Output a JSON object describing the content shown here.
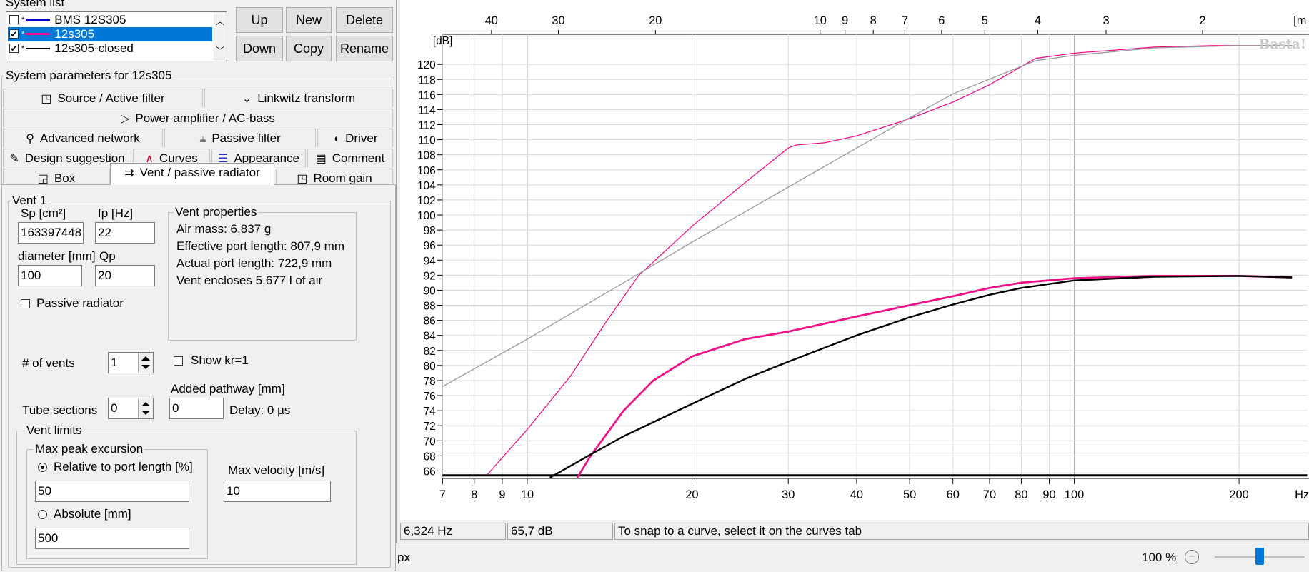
{
  "system_list": {
    "title": "System list",
    "items": [
      {
        "checked": false,
        "line_color": "#0000cc",
        "label": "BMS 12S305",
        "selected": false
      },
      {
        "checked": true,
        "line_color": "#ee1188",
        "label": "12s305",
        "selected": true
      },
      {
        "checked": true,
        "line_color": "#000000",
        "label": "12s305-closed",
        "selected": false
      }
    ],
    "buttons": {
      "up": "Up",
      "new": "New",
      "delete": "Delete",
      "down": "Down",
      "copy": "Copy",
      "rename": "Rename"
    }
  },
  "system_params": {
    "title": "System parameters for 12s305",
    "tabs": [
      {
        "key": "source",
        "icon": "◳",
        "label": "Source / Active filter"
      },
      {
        "key": "linkwitz",
        "icon": "⌄",
        "label": "Linkwitz transform"
      },
      {
        "key": "power",
        "icon": "▷",
        "label": "Power amplifier / AC-bass"
      },
      {
        "key": "advanced",
        "icon": "⚲",
        "label": "Advanced network"
      },
      {
        "key": "passive",
        "icon": "⫨",
        "label": "Passive filter"
      },
      {
        "key": "driver",
        "icon": "◖",
        "label": "Driver"
      },
      {
        "key": "design",
        "icon": "✎",
        "label": "Design suggestion"
      },
      {
        "key": "curves",
        "icon": "∧",
        "label": "Curves"
      },
      {
        "key": "appearance",
        "icon": "☰",
        "label": "Appearance"
      },
      {
        "key": "comment",
        "icon": "▤",
        "label": "Comment"
      },
      {
        "key": "box",
        "icon": "◲",
        "label": "Box"
      },
      {
        "key": "vent",
        "icon": "⇉",
        "label": "Vent / passive radiator"
      },
      {
        "key": "room",
        "icon": "◳",
        "label": "Room gain"
      }
    ]
  },
  "vent": {
    "group_title": "Vent 1",
    "sp_label": "Sp [cm²]",
    "sp_value": "163397448",
    "fp_label": "fp [Hz]",
    "fp_value": "22",
    "diameter_label": "diameter [mm]",
    "diameter_value": "100",
    "qp_label": "Qp",
    "qp_value": "20",
    "passive_radiator_label": "Passive radiator",
    "properties": {
      "title": "Vent properties",
      "air_mass": "Air mass: 6,837 g",
      "effective_length": "Effective port length: 807,9 mm",
      "actual_length": "Actual port length: 722,9 mm",
      "encloses": "Vent encloses 5,677 l of air"
    },
    "num_vents_label": "# of vents",
    "num_vents_value": "1",
    "show_kr_label": "Show kr=1",
    "added_pathway_label": "Added pathway [mm]",
    "added_pathway_value": "0",
    "tube_sections_label": "Tube sections",
    "tube_sections_value": "0",
    "delay_text": "Delay: 0 µs",
    "limits": {
      "title": "Vent limits",
      "max_peak_title": "Max peak excursion",
      "relative_label": "Relative to port length [%]",
      "relative_value": "50",
      "absolute_label": "Absolute [mm]",
      "absolute_value": "500",
      "max_velocity_label": "Max velocity [m/s]",
      "max_velocity_value": "10"
    }
  },
  "chart_data": {
    "type": "line",
    "ylabel": "[dB]",
    "watermark": "Basta!",
    "x_unit": "Hz",
    "top_axis_unit": "[m",
    "xscale": "log",
    "xlim": [
      7,
      250
    ],
    "ylim": [
      65,
      124
    ],
    "x_ticks": [
      7,
      8,
      9,
      10,
      20,
      30,
      40,
      50,
      60,
      70,
      80,
      90,
      100,
      200
    ],
    "x_ticklabels": [
      "7",
      "8",
      "9",
      "10",
      "20",
      "30",
      "40",
      "50",
      "60",
      "70",
      "80",
      "90",
      "100",
      "200"
    ],
    "y_ticks": [
      66,
      68,
      70,
      72,
      74,
      76,
      78,
      80,
      82,
      84,
      86,
      88,
      90,
      92,
      94,
      96,
      98,
      100,
      102,
      104,
      106,
      108,
      110,
      112,
      114,
      116,
      118,
      120
    ],
    "top_ticklabels": [
      "40",
      "30",
      "20",
      "10",
      "9",
      "8",
      "7",
      "6",
      "5",
      "4",
      "3",
      "2"
    ],
    "top_tick_freqs": [
      8.6,
      11.4,
      17.15,
      34.3,
      38.1,
      42.9,
      49,
      57.2,
      68.6,
      85.75,
      114.3,
      171.5
    ],
    "grid": true,
    "series": [
      {
        "color": "#ee1188",
        "width": 1.3,
        "x": [
          8.45,
          10,
          12,
          14,
          16,
          20,
          25,
          30,
          31,
          35,
          40,
          50,
          60,
          70,
          85,
          100,
          140,
          180,
          250
        ],
        "y": [
          65.5,
          71.5,
          78.6,
          86,
          92,
          98.5,
          104.3,
          108.9,
          109.3,
          109.6,
          110.5,
          112.8,
          115,
          117.3,
          120.8,
          121.5,
          122.3,
          122.5,
          122.5
        ]
      },
      {
        "color": "#999999",
        "width": 1.3,
        "x": [
          7,
          10,
          15,
          20,
          30,
          40,
          50,
          60,
          85,
          100,
          140,
          200,
          250
        ],
        "y": [
          77.2,
          83.5,
          91,
          96.4,
          103.7,
          108.9,
          112.9,
          116.1,
          120.5,
          121.2,
          122.2,
          122.5,
          122.5
        ]
      },
      {
        "color": "#ee1188",
        "width": 2.8,
        "x": [
          12.35,
          13,
          15,
          17,
          20,
          25,
          30,
          40,
          50,
          60,
          70,
          80,
          100,
          140,
          200,
          250
        ],
        "y": [
          65.1,
          67.8,
          74,
          78,
          81.2,
          83.5,
          84.5,
          86.5,
          88,
          89.2,
          90.3,
          91,
          91.6,
          91.9,
          91.9,
          91.7
        ]
      },
      {
        "color": "#000000",
        "width": 2.4,
        "x": [
          11,
          13,
          15,
          20,
          25,
          30,
          40,
          50,
          60,
          70,
          80,
          100,
          140,
          200,
          250
        ],
        "y": [
          65.1,
          68.1,
          70.6,
          74.9,
          78.2,
          80.5,
          84,
          86.4,
          88.1,
          89.4,
          90.3,
          91.3,
          91.8,
          91.9,
          91.7
        ]
      }
    ]
  },
  "status": {
    "frequency": "6,324 Hz",
    "level": "65,7 dB",
    "message": "To snap to a curve, select it on the curves tab"
  },
  "bottombar": {
    "unit": "px",
    "zoom": "100 %",
    "zoom_level_fraction": 0.5
  }
}
